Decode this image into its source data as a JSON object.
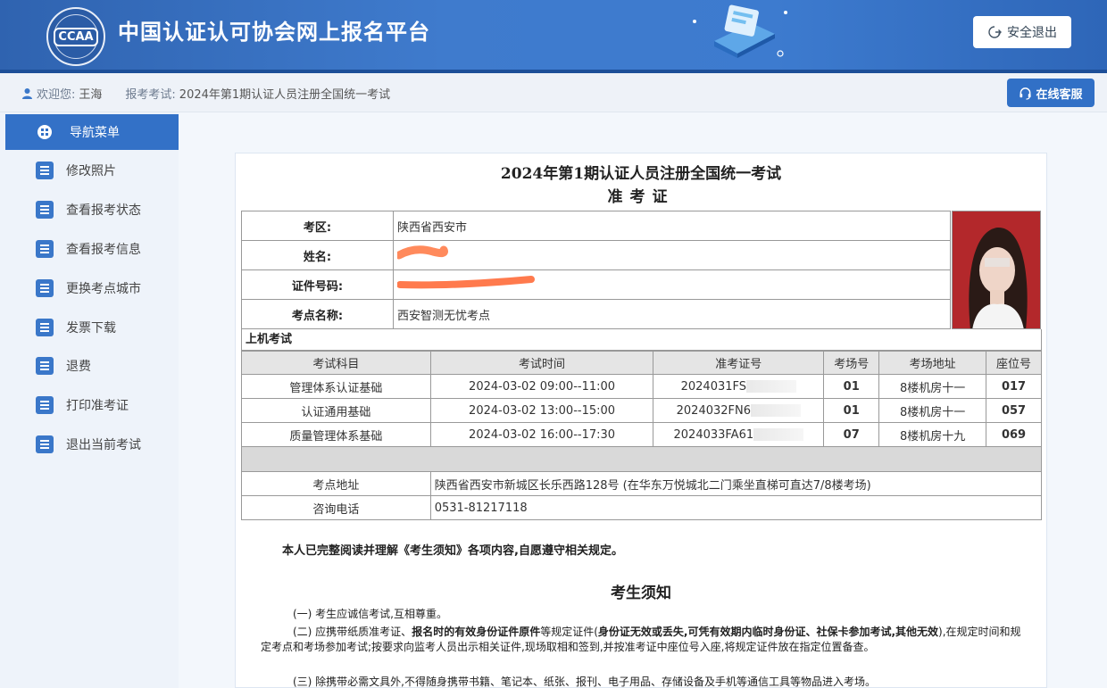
{
  "header": {
    "logo_text": "CCAA",
    "site_title": "中国认证认可协会网上报名平台",
    "logout_label": "安全退出"
  },
  "infobar": {
    "welcome_label": "欢迎您:",
    "user_name": "王海",
    "exam_label": "报考考试:",
    "exam_name": "2024年第1期认证人员注册全国统一考试",
    "service_label": "在线客服"
  },
  "sidebar": {
    "head": "导航菜单",
    "items": [
      {
        "label": "修改照片"
      },
      {
        "label": "查看报考状态"
      },
      {
        "label": "查看报考信息"
      },
      {
        "label": "更换考点城市"
      },
      {
        "label": "发票下载"
      },
      {
        "label": "退费"
      },
      {
        "label": "打印准考证"
      },
      {
        "label": "退出当前考试"
      }
    ]
  },
  "ticket": {
    "title": "2024年第1期认证人员注册全国统一考试",
    "subtitle": "准考证",
    "info": [
      {
        "label": "考区:",
        "value": "陕西省西安市"
      },
      {
        "label": "姓名:",
        "value": ""
      },
      {
        "label": "证件号码:",
        "value": ""
      },
      {
        "label": "考点名称:",
        "value": "西安智测无忧考点"
      }
    ],
    "section": "上机考试",
    "columns": [
      "考试科目",
      "考试时间",
      "准考证号",
      "考场号",
      "考场地址",
      "座位号"
    ],
    "rows": [
      {
        "subject": "管理体系认证基础",
        "time": "2024-03-02  09:00--11:00",
        "ticket_no": "2024031FS",
        "room": "01",
        "address": "8楼机房十一",
        "seat": "017"
      },
      {
        "subject": "认证通用基础",
        "time": "2024-03-02  13:00--15:00",
        "ticket_no": "2024032FN6",
        "room": "01",
        "address": "8楼机房十一",
        "seat": "057"
      },
      {
        "subject": "质量管理体系基础",
        "time": "2024-03-02  16:00--17:30",
        "ticket_no": "2024033FA61",
        "room": "07",
        "address": "8楼机房十九",
        "seat": "069"
      }
    ],
    "site_address_label": "考点地址",
    "site_address": "陕西省西安市新城区长乐西路128号 (在华东万悦城北二门乘坐直梯可直达7/8楼考场)",
    "phone_label": "咨询电话",
    "phone": "0531-81217118",
    "declaration": "本人已完整阅读并理解《考生须知》各项内容,自愿遵守相关规定。",
    "notice_title": "考生须知",
    "rule1": "(一) 考生应诚信考试,互相尊重。",
    "rule2_a": "(二) 应携带纸质准考证、",
    "rule2_b": "报名时的有效身份证件原件",
    "rule2_c": "等规定证件(",
    "rule2_d": "身份证无效或丢失,可凭有效期内临时身份证、社保卡参加考试,其他无效",
    "rule2_e": "),在规定时间和规定考点和考场参加考试;按要求向监考人员出示相关证件,现场取相和签到,并按准考证中座位号入座,将规定证件放在指定位置备查。",
    "rule3": "(三) 除携带必需文具外,不得随身携带书籍、笔记本、纸张、报刊、电子用品、存储设备及手机等通信工具等物品进入考场。"
  },
  "colors": {
    "header_blue": "#3f7bcd",
    "accent": "#3371c7"
  }
}
